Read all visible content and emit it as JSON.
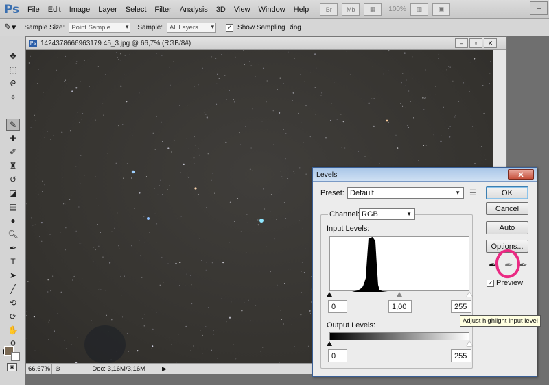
{
  "app": {
    "logo": "Ps"
  },
  "menu": [
    "File",
    "Edit",
    "Image",
    "Layer",
    "Select",
    "Filter",
    "Analysis",
    "3D",
    "View",
    "Window",
    "Help"
  ],
  "menubar_zoom": "100%",
  "options": {
    "sample_size_label": "Sample Size:",
    "sample_size_value": "Point Sample",
    "sample_label": "Sample:",
    "sample_value": "All Layers",
    "show_ring_label": "Show Sampling Ring",
    "show_ring_checked": true
  },
  "document": {
    "title": "1424378666963179 45_3.jpg @ 66,7% (RGB/8#)",
    "zoom": "66,67%",
    "doc_info": "Doc: 3,16M/3,16M"
  },
  "levels": {
    "title": "Levels",
    "preset_label": "Preset:",
    "preset_value": "Default",
    "channel_label": "Channel:",
    "channel_value": "RGB",
    "input_levels_label": "Input Levels:",
    "input_black": "0",
    "input_gamma": "1,00",
    "input_white": "255",
    "output_levels_label": "Output Levels:",
    "output_black": "0",
    "output_white": "255",
    "buttons": {
      "ok": "OK",
      "cancel": "Cancel",
      "auto": "Auto",
      "options": "Options..."
    },
    "preview_label": "Preview",
    "preview_checked": true,
    "tooltip": "Adjust highlight input level"
  },
  "colors": {
    "annotation": "#ea2a83",
    "dialog_title": "#b8d1ee"
  }
}
